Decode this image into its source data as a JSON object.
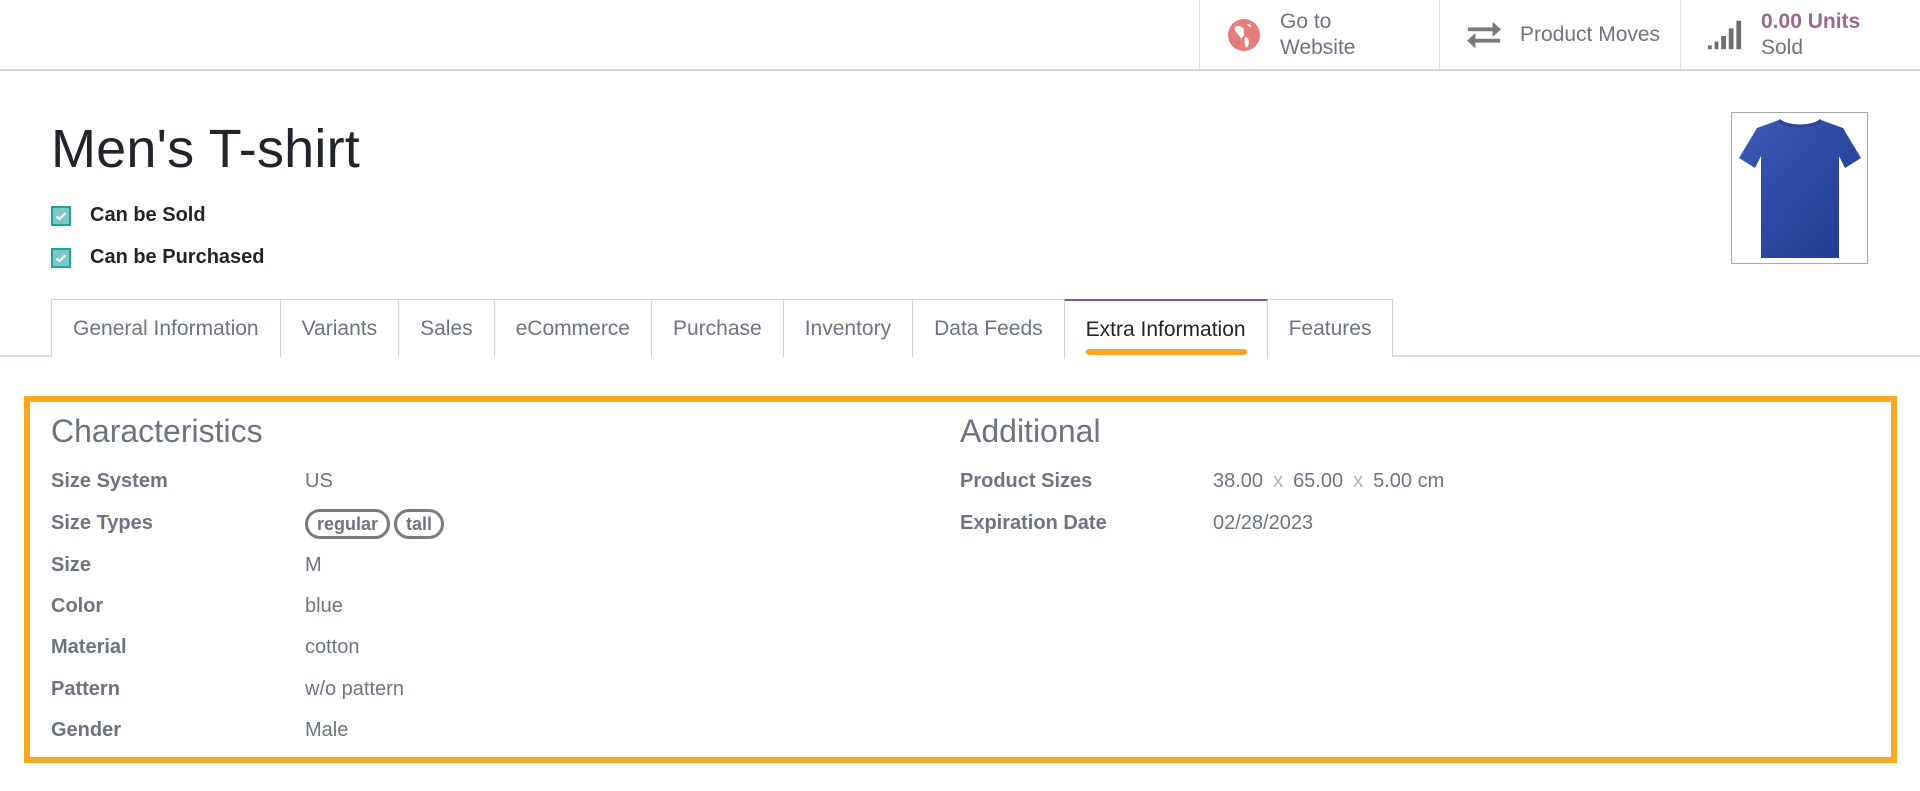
{
  "button_box": {
    "website": {
      "line1": "Go to",
      "line2": "Website",
      "icon": "globe-icon"
    },
    "moves": {
      "label": "Product Moves",
      "icon": "arrows-exchange-icon"
    },
    "sold": {
      "value": "0.00 Units",
      "label": "Sold",
      "icon": "signal-bars-icon"
    }
  },
  "product": {
    "name": "Men's T-shirt",
    "can_be_sold": {
      "label": "Can be Sold",
      "checked": true
    },
    "can_be_purchased": {
      "label": "Can be Purchased",
      "checked": true
    },
    "image_icon": "tshirt-image"
  },
  "tabs": [
    {
      "label": "General Information",
      "active": false
    },
    {
      "label": "Variants",
      "active": false
    },
    {
      "label": "Sales",
      "active": false
    },
    {
      "label": "eCommerce",
      "active": false
    },
    {
      "label": "Purchase",
      "active": false
    },
    {
      "label": "Inventory",
      "active": false
    },
    {
      "label": "Data Feeds",
      "active": false
    },
    {
      "label": "Extra Information",
      "active": true
    },
    {
      "label": "Features",
      "active": false
    }
  ],
  "characteristics": {
    "title": "Characteristics",
    "fields": [
      {
        "label": "Size System",
        "value": "US"
      },
      {
        "label": "Size Types",
        "tags": [
          "regular",
          "tall"
        ]
      },
      {
        "label": "Size",
        "value": "M"
      },
      {
        "label": "Color",
        "value": "blue"
      },
      {
        "label": "Material",
        "value": "cotton"
      },
      {
        "label": "Pattern",
        "value": "w/o pattern"
      },
      {
        "label": "Gender",
        "value": "Male"
      }
    ]
  },
  "additional": {
    "title": "Additional",
    "product_sizes": {
      "label": "Product Sizes",
      "length": "38.00",
      "width": "65.00",
      "height": "5.00",
      "separator": "x",
      "unit": "cm"
    },
    "expiration_date": {
      "label": "Expiration Date",
      "value": "02/28/2023"
    }
  },
  "colors": {
    "accent_purple": "#8b5a7c",
    "highlight_orange": "#f9a825",
    "checkbox_teal": "#1fa3a1",
    "globe_red": "#e57b7b"
  }
}
